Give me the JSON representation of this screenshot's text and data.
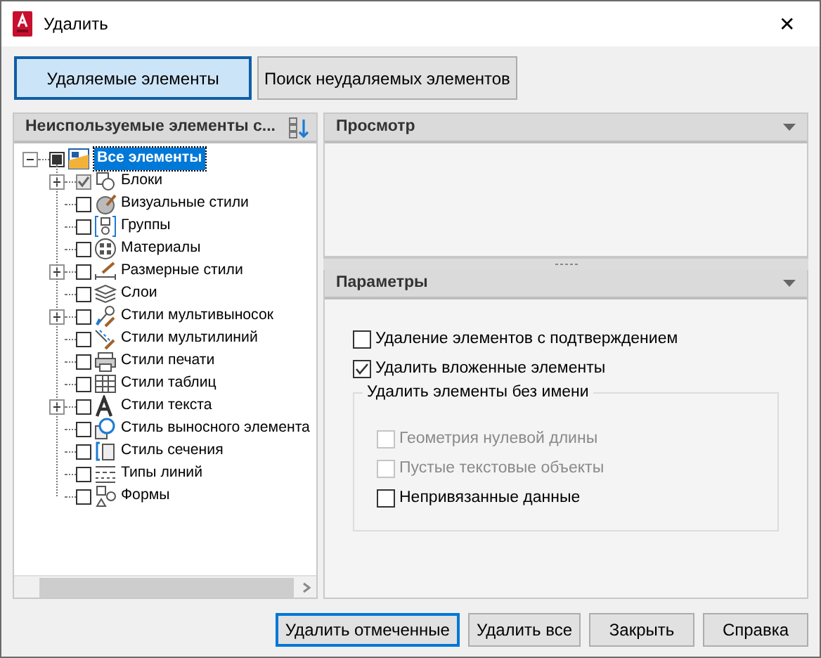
{
  "window": {
    "title": "Удалить",
    "close": "✕"
  },
  "tabs": [
    {
      "label": "Удаляемые элементы",
      "selected": true
    },
    {
      "label": "Поиск неудаляемых элементов",
      "selected": false
    }
  ],
  "tree_panel": {
    "title": "Неиспользуемые элементы с...",
    "root": {
      "label": "Все элементы",
      "expanded": true,
      "indeterminate": true,
      "selected": true,
      "children": [
        {
          "label": "Блоки",
          "kind": "collapsed",
          "checked": true
        },
        {
          "label": "Визуальные стили",
          "kind": "leaf",
          "checked": false
        },
        {
          "label": "Группы",
          "kind": "leaf",
          "checked": false
        },
        {
          "label": "Материалы",
          "kind": "leaf",
          "checked": false
        },
        {
          "label": "Размерные стили",
          "kind": "collapsed",
          "checked": false
        },
        {
          "label": "Слои",
          "kind": "leaf",
          "checked": false
        },
        {
          "label": "Стили мультивыносок",
          "kind": "collapsed",
          "checked": false
        },
        {
          "label": "Стили мультилиний",
          "kind": "leaf",
          "checked": false
        },
        {
          "label": "Стили печати",
          "kind": "leaf",
          "checked": false
        },
        {
          "label": "Стили таблиц",
          "kind": "leaf",
          "checked": false
        },
        {
          "label": "Стили текста",
          "kind": "collapsed",
          "checked": false
        },
        {
          "label": "Стиль выносного элемента",
          "kind": "leaf",
          "checked": false
        },
        {
          "label": "Стиль сечения",
          "kind": "leaf",
          "checked": false
        },
        {
          "label": "Типы линий",
          "kind": "leaf",
          "checked": false
        },
        {
          "label": "Формы",
          "kind": "leaf",
          "checked": false
        }
      ]
    }
  },
  "preview": {
    "title": "Просмотр"
  },
  "parameters": {
    "title": "Параметры",
    "options": [
      {
        "label": "Удаление элементов с подтверждением",
        "checked": false,
        "disabled": false
      },
      {
        "label": "Удалить вложенные элементы",
        "checked": true,
        "disabled": false
      }
    ],
    "group": {
      "title": "Удалить элементы без имени",
      "options": [
        {
          "label": "Геометрия нулевой длины",
          "checked": false,
          "disabled": true
        },
        {
          "label": "Пустые текстовые объекты",
          "checked": false,
          "disabled": true
        },
        {
          "label": "Непривязанные данные",
          "checked": false,
          "disabled": false
        }
      ]
    }
  },
  "buttons": [
    {
      "label": "Удалить отмеченные",
      "default": true
    },
    {
      "label": "Удалить все",
      "default": false
    },
    {
      "label": "Закрыть",
      "default": false
    },
    {
      "label": "Справка",
      "default": false
    }
  ]
}
